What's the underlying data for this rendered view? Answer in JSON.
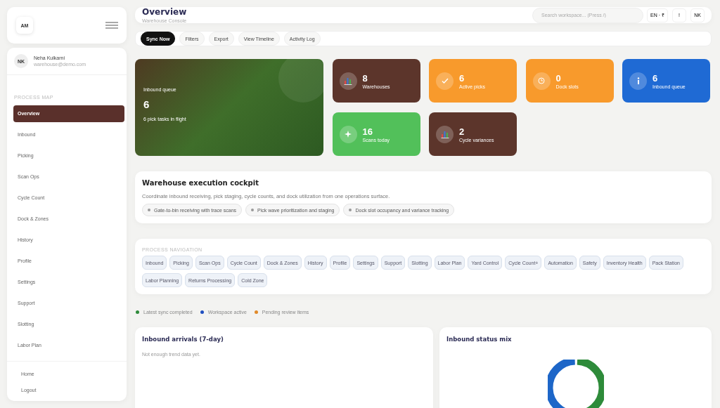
{
  "sidebar": {
    "logo": "AM",
    "user": {
      "initials": "NK",
      "name": "Neha Kulkarni",
      "email": "warehouse@demo.com"
    },
    "section_label": "PROCESS MAP",
    "items": [
      {
        "label": "Overview",
        "selected": true
      },
      {
        "label": "Inbound",
        "selected": false
      },
      {
        "label": "Picking",
        "selected": false
      },
      {
        "label": "Scan Ops",
        "selected": false
      },
      {
        "label": "Cycle Count",
        "selected": false
      },
      {
        "label": "Dock & Zones",
        "selected": false
      },
      {
        "label": "History",
        "selected": false
      },
      {
        "label": "Profile",
        "selected": false
      },
      {
        "label": "Settings",
        "selected": false
      },
      {
        "label": "Support",
        "selected": false
      },
      {
        "label": "Slotting",
        "selected": false
      },
      {
        "label": "Labor Plan",
        "selected": false
      }
    ],
    "footer_items": [
      "Home",
      "Logout"
    ]
  },
  "header": {
    "title": "Overview",
    "subtitle": "Warehouse Console",
    "search": {
      "placeholder": "Search workspace... (Press /)"
    },
    "chips": [
      "EN · ₹",
      "!",
      "NK"
    ]
  },
  "toolbar": [
    {
      "label": "Sync Now",
      "kind": "primary"
    },
    {
      "label": "Filters",
      "kind": "secondary"
    },
    {
      "label": "Export",
      "kind": "secondary"
    },
    {
      "label": "View Timeline",
      "kind": "secondary"
    },
    {
      "label": "Activity Log",
      "kind": "secondary"
    }
  ],
  "hero": {
    "label": "Inbound queue",
    "value": "6",
    "caption": "6 pick tasks in flight"
  },
  "stats": [
    {
      "value": "8",
      "label": "Warehouses",
      "kind": "chart",
      "color": "#5c352b"
    },
    {
      "value": "6",
      "label": "Active picks",
      "kind": "check",
      "color": "#f89a2c"
    },
    {
      "value": "0",
      "label": "Dock slots",
      "kind": "clock",
      "color": "#f89a2c"
    },
    {
      "value": "6",
      "label": "Inbound queue",
      "kind": "info",
      "color": "#1f6ad4"
    },
    {
      "value": "16",
      "label": "Scans today",
      "kind": "spark",
      "color": "#52c05a"
    },
    {
      "value": "2",
      "label": "Cycle variances",
      "kind": "chart",
      "color": "#5c352b"
    }
  ],
  "cockpit": {
    "title": "Warehouse execution cockpit",
    "description": "Coordinate inbound receiving, pick staging, cycle counts, and dock utilization from one operations surface.",
    "tags": [
      "Gate-to-bin receiving with trace scans",
      "Pick wave prioritization and staging",
      "Dock slot occupancy and variance tracking"
    ]
  },
  "process_navigation": {
    "label": "PROCESS NAVIGATION",
    "items": [
      "Inbound",
      "Picking",
      "Scan Ops",
      "Cycle Count",
      "Dock & Zones",
      "History",
      "Profile",
      "Settings",
      "Support",
      "Slotting",
      "Labor Plan",
      "Yard Control",
      "Cycle Count+",
      "Automation",
      "Safety",
      "Inventory Health",
      "Pack Station",
      "Labor Planning",
      "Returns Processing",
      "Cold Zone"
    ]
  },
  "legend": [
    {
      "label": "Latest sync completed",
      "color": "#2e8b3a"
    },
    {
      "label": "Workspace active",
      "color": "#1f4fc0"
    },
    {
      "label": "Pending review items",
      "color": "#e08a2a"
    }
  ],
  "panels": [
    {
      "title": "Inbound arrivals (7-day)",
      "kind": "empty",
      "message": "Not enough trend data yet."
    },
    {
      "title": "Inbound status mix",
      "kind": "donut"
    }
  ]
}
